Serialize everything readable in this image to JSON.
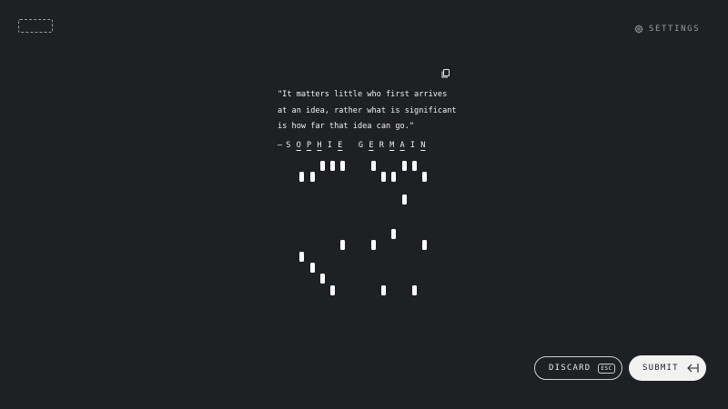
{
  "header": {
    "settings_label": "SETTINGS",
    "settings_icon": "gear-icon"
  },
  "quote": {
    "text": "\"It matters little who first arrives at an idea, rather what is significant is how far that idea can go.\"",
    "dash": "—",
    "author_letters": [
      "S",
      "O",
      "P",
      "H",
      "I",
      "E",
      " ",
      "G",
      "E",
      "R",
      "M",
      "A",
      "I",
      "N"
    ],
    "copy_icon": "copy-icon"
  },
  "actions": {
    "discard_label": "DISCARD",
    "discard_key": "ESC",
    "submit_label": "SUBMIT",
    "submit_icon": "enter-arrow-icon"
  }
}
